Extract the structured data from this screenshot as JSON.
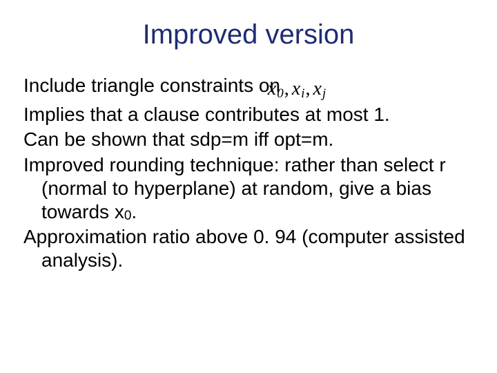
{
  "title": "Improved version",
  "lines": {
    "l1_pre": "Include triangle constraints on  ",
    "math_x0": "x",
    "math_x0_sub": "0",
    "math_comma1": ",",
    "math_xi": "x",
    "math_xi_sub": "i",
    "math_comma2": ",",
    "math_xj": "x",
    "math_xj_sub": "j",
    "l2": "Implies that a clause contributes at most 1.",
    "l3": "Can be shown that sdp=m iff opt=m.",
    "l4": "Improved rounding technique: rather than select r (normal to hyperplane) at random, give a bias towards x",
    "l4_sub": "0",
    "l4_post": ".",
    "l5": "Approximation ratio above 0. 94 (computer assisted analysis)."
  }
}
